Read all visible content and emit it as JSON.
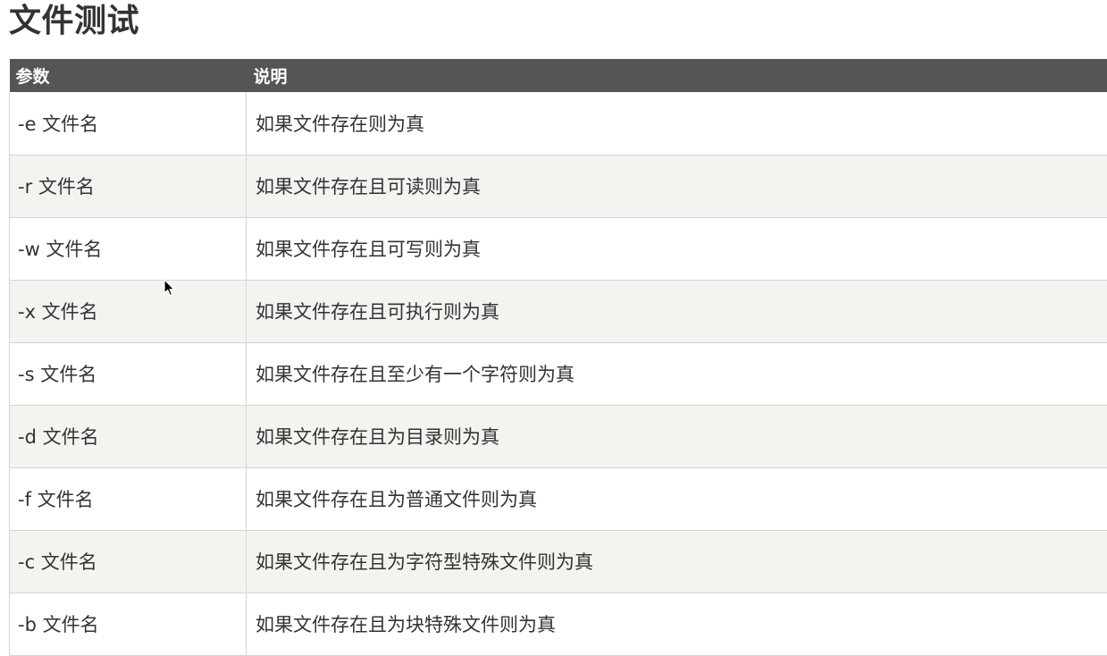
{
  "page": {
    "title": "文件测试"
  },
  "table": {
    "headers": {
      "param": "参数",
      "description": "说明"
    },
    "rows": [
      {
        "param": "-e 文件名",
        "description": "如果文件存在则为真"
      },
      {
        "param": "-r 文件名",
        "description": "如果文件存在且可读则为真"
      },
      {
        "param": "-w 文件名",
        "description": "如果文件存在且可写则为真"
      },
      {
        "param": "-x 文件名",
        "description": "如果文件存在且可执行则为真"
      },
      {
        "param": "-s 文件名",
        "description": "如果文件存在且至少有一个字符则为真"
      },
      {
        "param": "-d 文件名",
        "description": "如果文件存在且为目录则为真"
      },
      {
        "param": "-f 文件名",
        "description": "如果文件存在且为普通文件则为真"
      },
      {
        "param": "-c 文件名",
        "description": "如果文件存在且为字符型特殊文件则为真"
      },
      {
        "param": "-b 文件名",
        "description": "如果文件存在且为块特殊文件则为真"
      }
    ]
  },
  "colors": {
    "header_bg": "#555555",
    "header_text": "#ffffff",
    "row_alt_bg": "#f4f3f0",
    "text": "#333333"
  },
  "icons": {
    "cursor": "mouse-pointer-icon"
  }
}
